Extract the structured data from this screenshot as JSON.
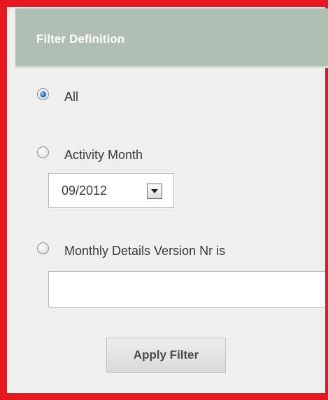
{
  "header": {
    "title": "Filter Definition"
  },
  "filters": {
    "all": {
      "label": "All",
      "checked": true
    },
    "activity_month": {
      "label": "Activity Month",
      "checked": false,
      "selected_value": "09/2012"
    },
    "version_nr": {
      "label": "Monthly Details Version Nr is",
      "checked": false,
      "value": ""
    }
  },
  "apply_button": {
    "label": "Apply Filter"
  },
  "colors": {
    "frame_border": "#e8181f",
    "header_bg": "#b0bfb4",
    "panel_bg": "#efefef"
  }
}
